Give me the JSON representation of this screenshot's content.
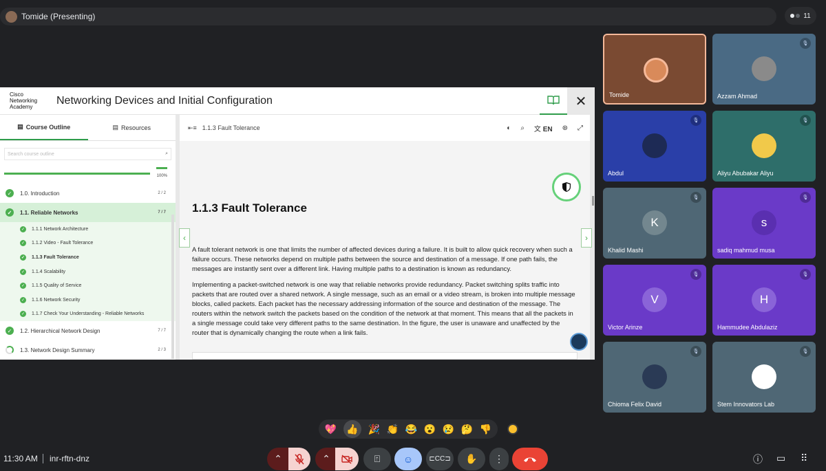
{
  "topbar": {
    "presenter_label": "Tomide (Presenting)",
    "people_count": "11"
  },
  "presentation": {
    "logo_lines": [
      "Cisco",
      "Networking",
      "Academy"
    ],
    "course_title": "Networking Devices and Initial Configuration",
    "close_glyph": "✕",
    "sidebar": {
      "tabs": [
        {
          "label": "Course Outline"
        },
        {
          "label": "Resources"
        }
      ],
      "search_placeholder": "Search course outline",
      "progress_percent": 100,
      "progress_label": "100%",
      "sections": [
        {
          "label": "1.0. Introduction",
          "count": "2 / 2"
        },
        {
          "label": "1.1. Reliable Networks",
          "count": "7 / 7"
        },
        {
          "label": "1.2. Hierarchical Network Design",
          "count": "7 / 7"
        },
        {
          "label": "1.3. Network Design Summary",
          "count": "2 / 3"
        }
      ],
      "subsections": [
        "1.1.1 Network Architecture",
        "1.1.2 Video - Fault Tolerance",
        "1.1.3 Fault Tolerance",
        "1.1.4 Scalability",
        "1.1.5 Quality of Service",
        "1.1.6 Network Security",
        "1.1.7 Check Your Understanding - Reliable Networks"
      ]
    },
    "content": {
      "breadcrumb": "1.1.3 Fault Tolerance",
      "language": "EN",
      "heading": "1.1.3 Fault Tolerance",
      "paragraph1": "A fault tolerant network is one that limits the number of affected devices during a failure. It is built to allow quick recovery when such a failure occurs. These networks depend on multiple paths between the source and destination of a message. If one path fails, the messages are instantly sent over a different link. Having multiple paths to a destination is known as redundancy.",
      "paragraph2": "Implementing a packet-switched network is one way that reliable networks provide redundancy. Packet switching splits traffic into packets that are routed over a shared network. A single message, such as an email or a video stream, is broken into multiple message blocks, called packets. Each packet has the necessary addressing information of the source and destination of the message. The routers within the network switch the packets based on the condition of the network at that moment. This means that all the packets in a single message could take very different paths to the same destination. In the figure, the user is unaware and unaffected by the router that is dynamically changing the route when a link fails."
    }
  },
  "participants": [
    {
      "name": "Tomide",
      "initial": "",
      "bg": "#7a4a32",
      "avatar_bg": "#d98a5a",
      "muted": false
    },
    {
      "name": "Azzam Ahmad",
      "initial": "",
      "bg": "#4a6a84",
      "avatar_bg": "#8a8a8a",
      "muted": true
    },
    {
      "name": "Abdul",
      "initial": "",
      "bg": "#2a3fa8",
      "avatar_bg": "#1d2a55",
      "muted": true
    },
    {
      "name": "Aliyu Abubakar Aliyu",
      "initial": "",
      "bg": "#2e6e6a",
      "avatar_bg": "#f1c94a",
      "muted": true
    },
    {
      "name": "Khalid Mashi",
      "initial": "K",
      "bg": "#4f6775",
      "avatar_bg": "#73878f",
      "muted": true
    },
    {
      "name": "sadiq mahmud musa",
      "initial": "s",
      "bg": "#6a3ac8",
      "avatar_bg": "#5a2fb0",
      "muted": true
    },
    {
      "name": "Victor Arinze",
      "initial": "V",
      "bg": "#6a3ac8",
      "avatar_bg": "#8a64d8",
      "muted": true
    },
    {
      "name": "Hammudee Abdulaziz",
      "initial": "H",
      "bg": "#6a3ac8",
      "avatar_bg": "#8a64d8",
      "muted": true
    },
    {
      "name": "Chioma Felix David",
      "initial": "",
      "bg": "#4f6775",
      "avatar_bg": "#2a3a55",
      "muted": true
    },
    {
      "name": "Stem Innovators Lab",
      "initial": "",
      "bg": "#4f6775",
      "avatar_bg": "#ffffff",
      "muted": true
    }
  ],
  "reactions": [
    "💖",
    "👍",
    "🎉",
    "👏",
    "😂",
    "😮",
    "😢",
    "🤔",
    "👎"
  ],
  "bottombar": {
    "time": "11:30 AM",
    "meeting_code": "inr-rftn-dnz"
  },
  "colors": {
    "accent_green": "#4caf50",
    "end_call_red": "#ea4335",
    "bg_dark": "#202124"
  }
}
